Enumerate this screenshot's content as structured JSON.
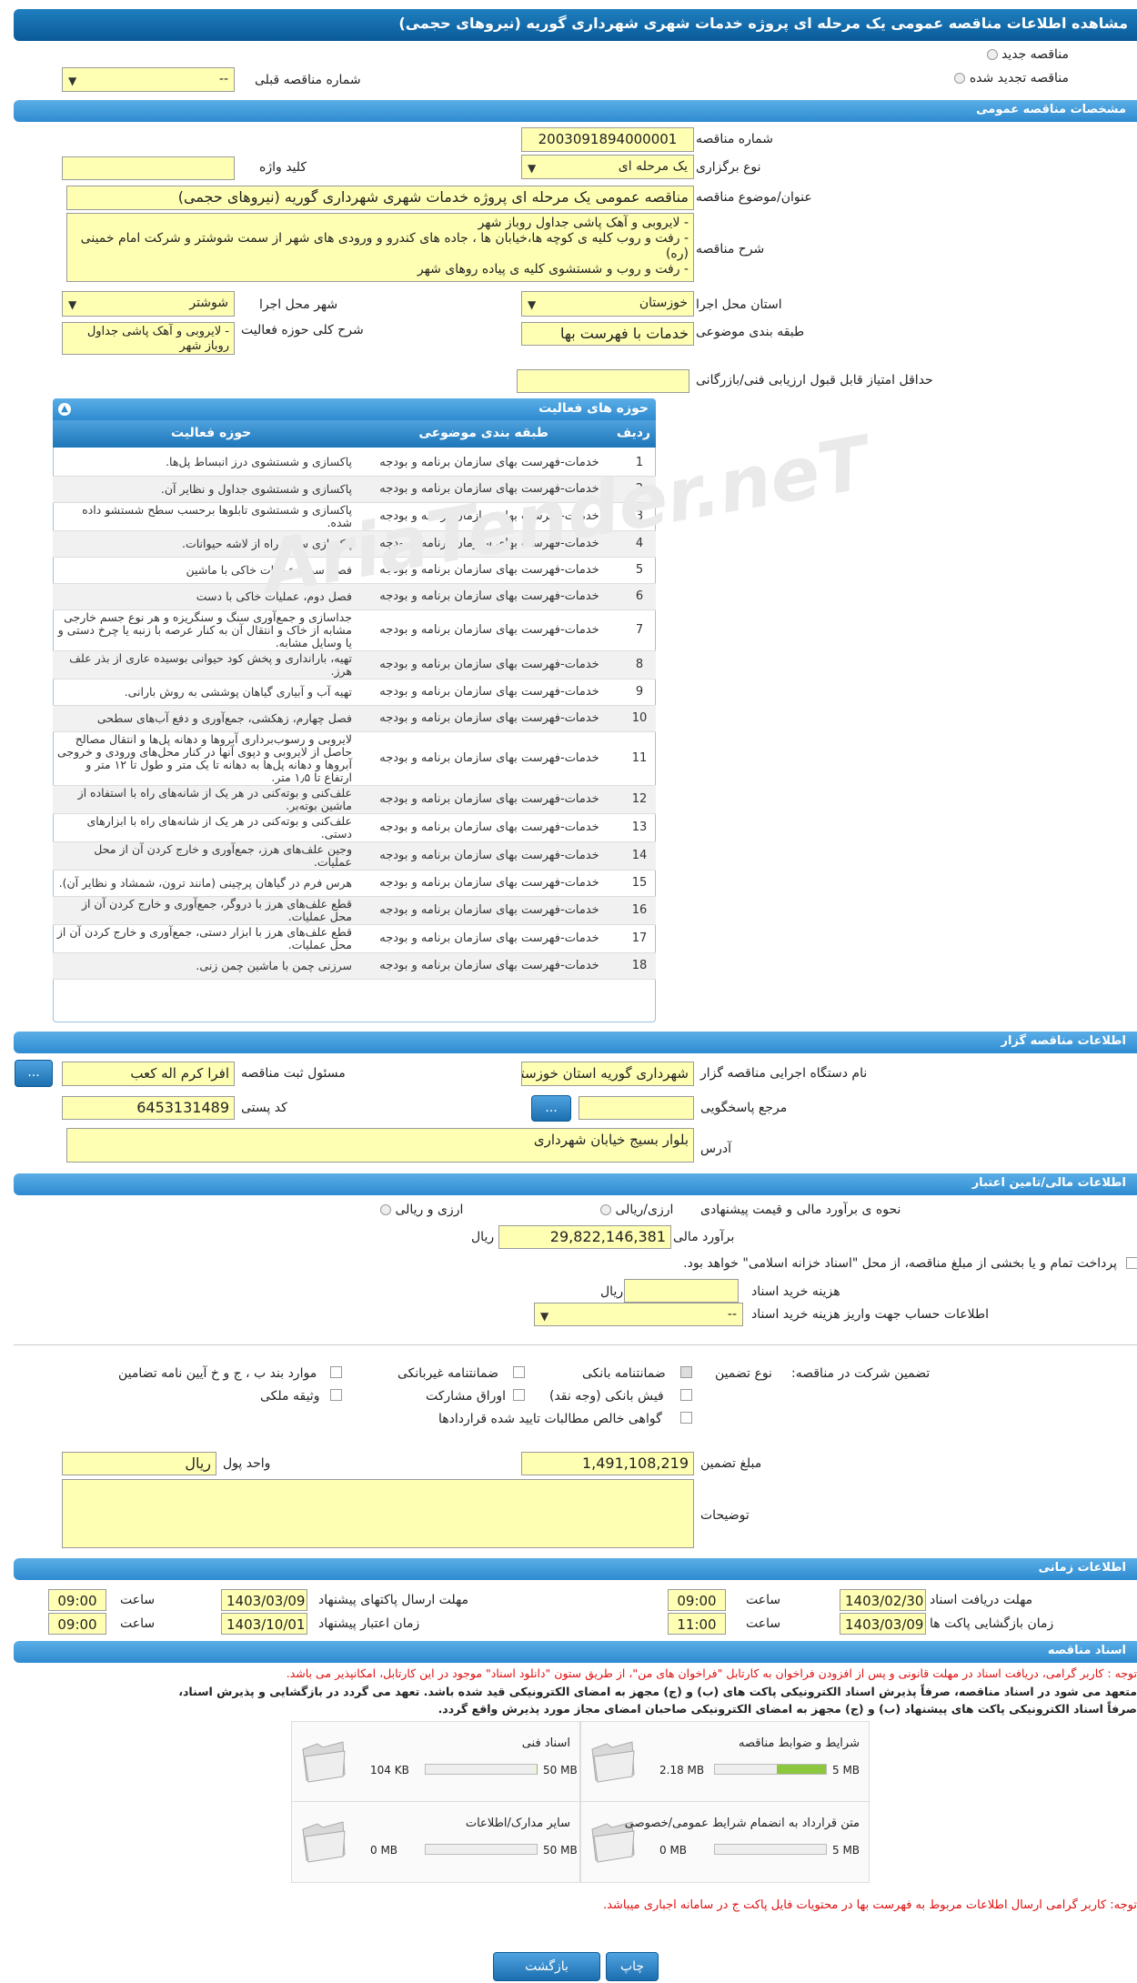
{
  "title": "مشاهده اطلاعات مناقصه عمومی یک مرحله ای پروژه خدمات شهری شهرداری گوریه (نیروهای حجمی)",
  "top": {
    "new_label": "مناقصه جدید",
    "renew_label": "مناقصه تجدید شده",
    "prev_label": "شماره مناقصه قبلی",
    "prev_value": "--"
  },
  "sections": {
    "general": "مشخصات مناقصه عمومی",
    "organizer": "اطلاعات مناقصه گزار",
    "financial": "اطلاعات مالی/تامین اعتبار",
    "timing": "اطلاعات زمانی",
    "docs": "اسناد مناقصه"
  },
  "general": {
    "number_label": "شماره مناقصه",
    "number": "2003091894000001",
    "type_label": "نوع برگزاری",
    "type": "یک مرحله ای",
    "keyword_label": "کلید واژه",
    "keyword": "",
    "subject_label": "عنوان/موضوع مناقصه",
    "subject": "مناقصه عمومی یک مرحله ای پروژه خدمات شهری شهرداری گوریه (نیروهای حجمی)",
    "desc_label": "شرح مناقصه",
    "desc_lines": [
      "-     لایروبی و آهک پاشی جداول روباز شهر",
      "-     رفت و روب کلیه ی کوچه ها،خیابان ها ، جاده های کندرو و ورودی های شهر از سمت شوشتر و شرکت امام خمینی (ره)",
      "-     رفت و روب و شستشوی کلیه ی پیاده روهای شهر"
    ],
    "province_label": "استان محل اجرا",
    "province": "خوزستان",
    "city_label": "شهر محل اجرا",
    "city": "شوشتر",
    "category_label": "طبقه بندی موضوعی",
    "category": "خدمات با فهرست بها",
    "scope_label": "شرح کلی حوزه فعالیت",
    "scope": "-      لایروبی و آهک پاشی جداول روباز شهر",
    "min_score_label": "حداقل امتیاز قابل قبول ارزیابی فنی/بازرگانی",
    "min_score": ""
  },
  "activity": {
    "title": "حوزه های فعالیت",
    "headers": {
      "row": "ردیف",
      "category": "طبقه بندی موضوعی",
      "activity": "حوزه فعالیت"
    },
    "rows": [
      {
        "n": "1",
        "c": "خدمات-فهرست بهای سازمان برنامه و بودجه",
        "a": "پاکسازی و شستشوی درز انبساط پل‌ها."
      },
      {
        "n": "2",
        "c": "خدمات-فهرست بهای سازمان برنامه و بودجه",
        "a": "پاکسازی و شستشوی جداول و نظایر آن."
      },
      {
        "n": "3",
        "c": "خدمات-فهرست بهای سازمان برنامه و بودجه",
        "a": "پاکسازی و شستشوی تابلوها برحسب سطح شستشو داده شده."
      },
      {
        "n": "4",
        "c": "خدمات-فهرست بهای سازمان برنامه و بودجه",
        "a": "پاکسازی سطح راه از لاشه حیوانات."
      },
      {
        "n": "5",
        "c": "خدمات-فهرست بهای سازمان برنامه و بودجه",
        "a": "فصل سوم، عملیات خاکی با ماشین"
      },
      {
        "n": "6",
        "c": "خدمات-فهرست بهای سازمان برنامه و بودجه",
        "a": "فصل دوم، عملیات خاکی با دست"
      },
      {
        "n": "7",
        "c": "خدمات-فهرست بهای سازمان برنامه و بودجه",
        "a": "جداسازی و جمع‌آوری سنگ و سنگریزه و هر نوع جسم خارجی مشابه از خاک و انتقال آن به کنار عرصه با زنبه یا چرخ دستی و یا وسایل مشابه."
      },
      {
        "n": "8",
        "c": "خدمات-فهرست بهای سازمان برنامه و بودجه",
        "a": "تهیه، بارانداری و پخش کود حیوانی بوسیده عاری از بذر علف هرز."
      },
      {
        "n": "9",
        "c": "خدمات-فهرست بهای سازمان برنامه و بودجه",
        "a": "تهیه آب و آبیاری گیاهان پوششی به روش بارانی."
      },
      {
        "n": "10",
        "c": "خدمات-فهرست بهای سازمان برنامه و بودجه",
        "a": "فصل چهارم، زهکشی، جمع‌آوری و دفع آب‌های سطحی"
      },
      {
        "n": "11",
        "c": "خدمات-فهرست بهای سازمان برنامه و بودجه",
        "a": "لایروبی و رسوب‌برداری آبروها و دهانه پل‌ها و انتقال مصالح حاصل از لایروبی و دپوی آنها در کنار محل‌های ورودی و خروجی آبروها و دهانه پل‌ها به دهانه تا یک متر و طول تا ۱۲ متر و ارتفاع تا ۱٫۵ متر."
      },
      {
        "n": "12",
        "c": "خدمات-فهرست بهای سازمان برنامه و بودجه",
        "a": "علف‌کنی و بوته‌کنی در هر یک از شانه‌های راه با استفاده از ماشین بوته‌بر."
      },
      {
        "n": "13",
        "c": "خدمات-فهرست بهای سازمان برنامه و بودجه",
        "a": "علف‌کنی و بوته‌کنی در هر یک از شانه‌های راه با ابزارهای دستی."
      },
      {
        "n": "14",
        "c": "خدمات-فهرست بهای سازمان برنامه و بودجه",
        "a": "وجین علف‌های هرز، جمع‌آوری و خارج کردن آن از محل عملیات."
      },
      {
        "n": "15",
        "c": "خدمات-فهرست بهای سازمان برنامه و بودجه",
        "a": "هرس فرم در گیاهان پرچینی (مانند ترون، شمشاد و نظایر آن)."
      },
      {
        "n": "16",
        "c": "خدمات-فهرست بهای سازمان برنامه و بودجه",
        "a": "قطع علف‌های هرز با دروگر، جمع‌آوری و خارج کردن آن از محل عملیات."
      },
      {
        "n": "17",
        "c": "خدمات-فهرست بهای سازمان برنامه و بودجه",
        "a": "قطع علف‌های هرز با ابزار دستی، جمع‌آوری و خارج کردن آن از محل عملیات."
      },
      {
        "n": "18",
        "c": "خدمات-فهرست بهای سازمان برنامه و بودجه",
        "a": "سرزنی چمن با ماشین چمن زنی."
      }
    ]
  },
  "organizer": {
    "org_label": "نام دستگاه اجرایی مناقصه گزار",
    "org": "شهرداری گوریه استان خوزستان",
    "resp_label": "مسئول ثبت مناقصه",
    "resp": "افرا کرم اله کعب",
    "ref_label": "مرجع پاسخگویی",
    "ref": "",
    "postal_label": "کد پستی",
    "postal": "6453131489",
    "addr_label": "آدرس",
    "addr": "بلوار بسیج خیابان شهرداری",
    "more_btn": "..."
  },
  "financial": {
    "method_label": "نحوه ی برآورد مالی و قیمت پیشنهادی",
    "opt1": "ارزی/ریالی",
    "opt2": "ارزی و ریالی",
    "estimate_label": "برآورد مالی",
    "estimate": "29,822,146,381",
    "rial": "ریال",
    "treasury": "پرداخت تمام و یا بخشی از مبلغ مناقصه، از محل \"اسناد خزانه اسلامی\" خواهد بود.",
    "doc_fee_label": "هزینه خرید اسناد",
    "doc_fee": "",
    "account_label": "اطلاعات حساب جهت واریز هزینه خرید اسناد",
    "account": "--",
    "guarantee_label": "تضمین شرکت در مناقصه:",
    "gtype_label": "نوع تضمین",
    "g_items": [
      "ضمانتنامه بانکی",
      "ضمانتنامه غیربانکی",
      "موارد بند ب ، ج و خ آیین نامه تضامین",
      "فیش بانکی (وجه نقد)",
      "اوراق مشارکت",
      "وثیقه ملکی",
      "گواهی خالص مطالبات تایید شده قراردادها"
    ],
    "amount_label": "مبلغ تضمین",
    "amount": "1,491,108,219",
    "currency_label": "واحد پول",
    "currency": "ریال",
    "notes_label": "توضیحات",
    "notes": ""
  },
  "timing": {
    "receive_label": "مهلت دریافت اسناد",
    "receive_date": "1403/02/30",
    "receive_time": "09:00",
    "send_label": "مهلت ارسال پاکتهای پیشنهاد",
    "send_date": "1403/03/09",
    "send_time": "09:00",
    "open_label": "زمان بازگشایی پاکت ها",
    "open_date": "1403/03/09",
    "open_time": "11:00",
    "valid_label": "زمان اعتبار پیشنهاد",
    "valid_date": "1403/10/01",
    "valid_time": "09:00",
    "time_label": "ساعت"
  },
  "docs": {
    "note1": "توجه : کاربر گرامی، دریافت اسناد در مهلت قانونی و پس از افزودن فراخوان به کارتابل \"فراخوان های من\"، از طریق ستون \"دانلود اسناد\" موجود در این کارتابل، امکانپذیر می باشد.",
    "note2": "متعهد می شود در اسناد مناقصه، صرفاً پذیرش اسناد الکترونیکی پاکت های (ب) و (ج) مجهز به امضای الکترونیکی قید شده باشد. تعهد می گردد در بازگشایی و پذیرش اسناد،",
    "note3": "صرفاً اسناد الکترونیکی پاکت های پیشنهاد (ب) و (ج) مجهز به امضای الکترونیکی صاحبان امضای مجاز مورد پذیرش واقع گردد.",
    "files": [
      {
        "name": "شرایط و ضوابط مناقصه",
        "max": "5 MB",
        "cur": "2.18 MB",
        "fill": 0.44
      },
      {
        "name": "اسناد فنی",
        "max": "50 MB",
        "cur": "104 KB",
        "fill": 0.002
      },
      {
        "name": "متن قرارداد به انضمام شرایط عمومی/خصوصی",
        "max": "5 MB",
        "cur": "0 MB",
        "fill": 0
      },
      {
        "name": "سایر مدارک/اطلاعات",
        "max": "50 MB",
        "cur": "0 MB",
        "fill": 0
      }
    ],
    "note4": "توجه: کاربر گرامی ارسال اطلاعات مربوط به فهرست بها در محتویات فایل پاکت ج در سامانه اجباری میباشد."
  },
  "buttons": {
    "print": "چاپ",
    "back": "بازگشت"
  },
  "watermark": "AriaTender.neT"
}
